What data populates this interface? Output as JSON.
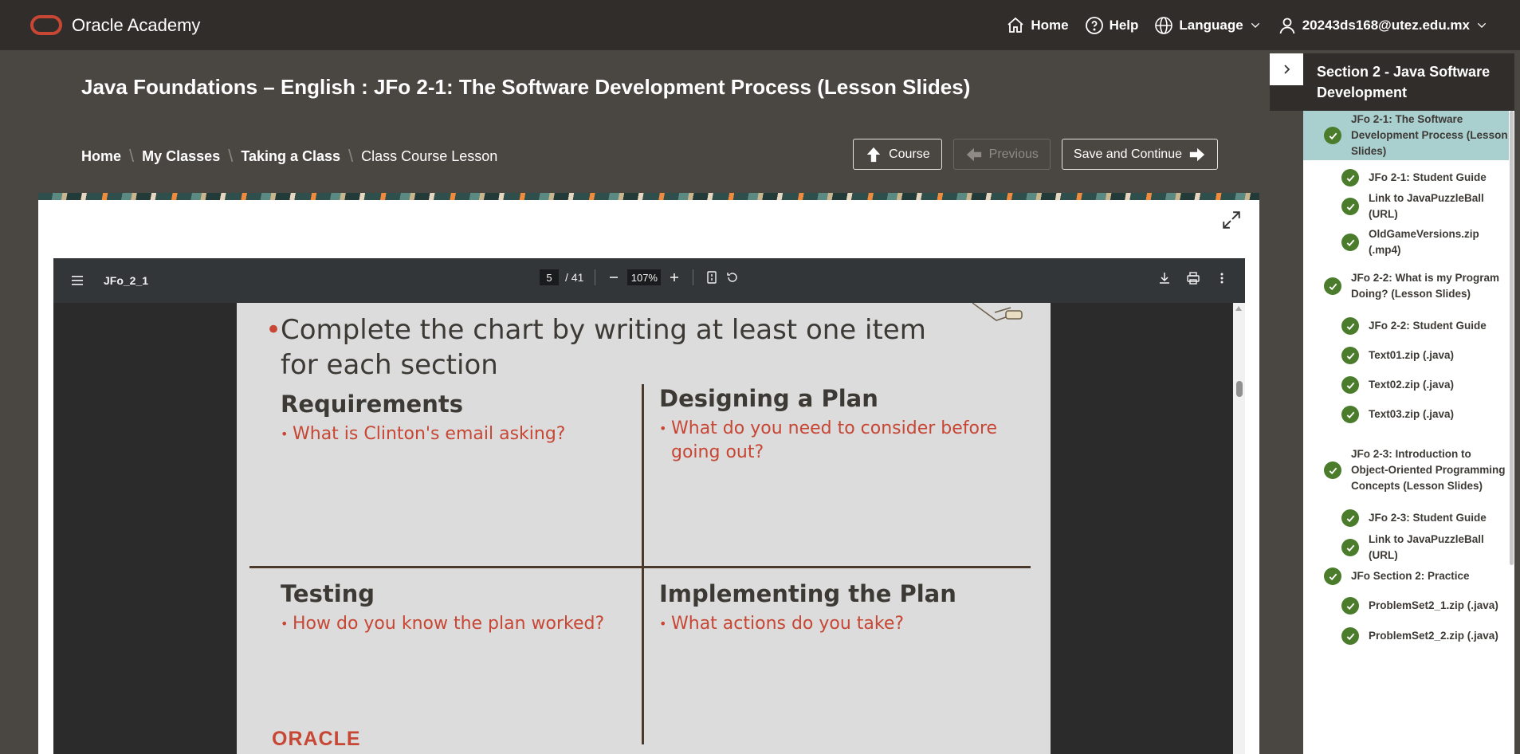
{
  "brand": {
    "name": "Oracle Academy"
  },
  "topnav": {
    "home": "Home",
    "help": "Help",
    "language": "Language",
    "user": "20243ds168@utez.edu.mx"
  },
  "page": {
    "title": "Java Foundations – English : JFo 2-1: The Software Development Process (Lesson Slides)"
  },
  "breadcrumb": {
    "items": [
      "Home",
      "My Classes",
      "Taking a Class"
    ],
    "current": "Class Course Lesson",
    "separator": "\\"
  },
  "buttons": {
    "course": "Course",
    "previous": "Previous",
    "save_continue": "Save and Continue"
  },
  "pdf": {
    "filename": "JFo_2_1",
    "page": "5",
    "total": "/ 41",
    "zoom": "107%"
  },
  "slide": {
    "main_bullet": "Complete the chart by writing at least one item for each section",
    "quadrants": [
      {
        "title": "Requirements",
        "item": "What is Clinton's email asking?"
      },
      {
        "title": "Designing a Plan",
        "item": "What do you need to consider before going out?"
      },
      {
        "title": "Testing",
        "item": "How do you know the plan worked?"
      },
      {
        "title": "Implementing the Plan",
        "item": "What actions do you take?"
      }
    ],
    "logo": "ORACLE"
  },
  "sidebar": {
    "title": "Section 2 - Java Software Development",
    "items": [
      {
        "label": "JFo 2-1: The Software Development Process (Lesson Slides)",
        "level": 1,
        "active": true
      },
      {
        "label": "JFo 2-1: Student Guide",
        "level": 2
      },
      {
        "label": "Link to JavaPuzzleBall (URL)",
        "level": 2
      },
      {
        "label": "OldGameVersions.zip (.mp4)",
        "level": 2
      },
      {
        "label": "JFo 2-2: What is my Program Doing? (Lesson Slides)",
        "level": 1
      },
      {
        "label": "JFo 2-2: Student Guide",
        "level": 2
      },
      {
        "label": "Text01.zip (.java)",
        "level": 2
      },
      {
        "label": "Text02.zip (.java)",
        "level": 2
      },
      {
        "label": "Text03.zip (.java)",
        "level": 2
      },
      {
        "label": "JFo 2-3: Introduction to Object-Oriented Programming Concepts (Lesson Slides)",
        "level": 1
      },
      {
        "label": "JFo 2-3: Student Guide",
        "level": 2
      },
      {
        "label": "Link to JavaPuzzleBall (URL)",
        "level": 2
      },
      {
        "label": "JFo Section 2: Practice",
        "level": 1
      },
      {
        "label": "ProblemSet2_1.zip (.java)",
        "level": 2
      },
      {
        "label": "ProblemSet2_2.zip (.java)",
        "level": 2
      }
    ]
  },
  "colors": {
    "oracle_red": "#c74634",
    "topbar": "#312d2a",
    "header": "#4a4641",
    "active_item": "#aacfcf",
    "check_green": "#4a7c2c"
  }
}
